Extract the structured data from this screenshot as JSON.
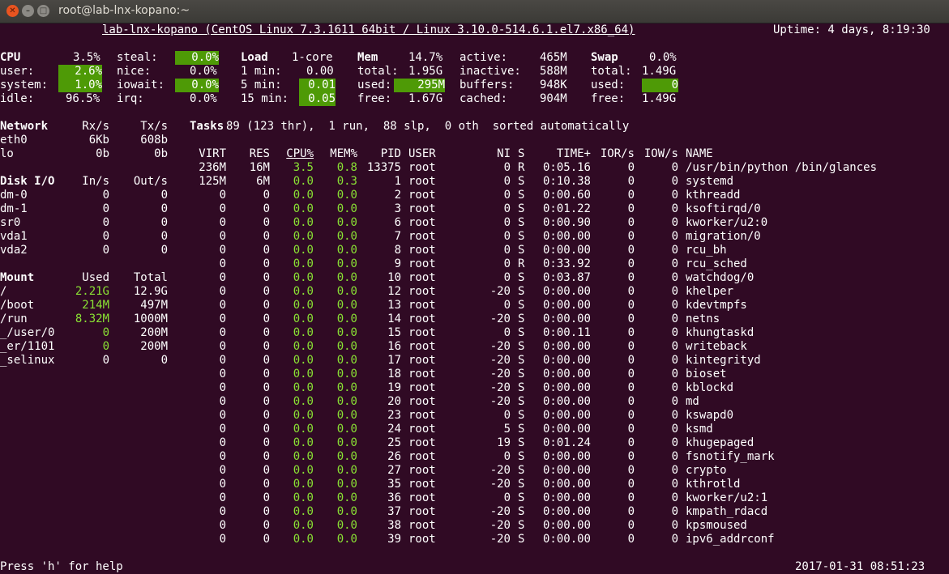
{
  "window": {
    "title": "root@lab-lnx-kopano:~",
    "close_glyph": "✕",
    "minimize_glyph": "–",
    "maximize_glyph": "□"
  },
  "header": {
    "system": "lab-lnx-kopano (CentOS Linux 7.3.1611 64bit / Linux 3.10.0-514.6.1.el7.x86_64)",
    "uptime": "Uptime: 4 days, 8:19:30"
  },
  "cpu": {
    "title": "CPU",
    "total": "3.5%",
    "user_label": "user:",
    "user": "2.6%",
    "system_label": "system:",
    "system": "1.0%",
    "idle_label": "idle:",
    "idle": "96.5%",
    "steal_label": "steal:",
    "steal": "0.0%",
    "nice_label": "nice:",
    "nice": "0.0%",
    "iowait_label": "iowait:",
    "iowait": "0.0%",
    "irq_label": "irq:",
    "irq": "0.0%"
  },
  "load": {
    "title": "Load",
    "cores": "1-core",
    "min1_label": "1 min:",
    "min1": "0.00",
    "min5_label": "5 min:",
    "min5": "0.01",
    "min15_label": "15 min:",
    "min15": "0.05"
  },
  "mem": {
    "title": "Mem",
    "percent": "14.7%",
    "total_label": "total:",
    "total": "1.95G",
    "used_label": "used:",
    "used": "295M",
    "free_label": "free:",
    "free": "1.67G",
    "active_label": "active:",
    "active": "465M",
    "inactive_label": "inactive:",
    "inactive": "588M",
    "buffers_label": "buffers:",
    "buffers": "948K",
    "cached_label": "cached:",
    "cached": "904M"
  },
  "swap": {
    "title": "Swap",
    "percent": "0.0%",
    "total_label": "total:",
    "total": "1.49G",
    "used_label": "used:",
    "used": "0",
    "free_label": "free:",
    "free": "1.49G"
  },
  "network": {
    "title": "Network",
    "rx_header": "Rx/s",
    "tx_header": "Tx/s",
    "rows": [
      {
        "name": "eth0",
        "rx": "6Kb",
        "tx": "608b"
      },
      {
        "name": "lo",
        "rx": "0b",
        "tx": "0b"
      }
    ]
  },
  "disk": {
    "title": "Disk I/O",
    "in_header": "In/s",
    "out_header": "Out/s",
    "rows": [
      {
        "name": "dm-0",
        "in": "0",
        "out": "0"
      },
      {
        "name": "dm-1",
        "in": "0",
        "out": "0"
      },
      {
        "name": "sr0",
        "in": "0",
        "out": "0"
      },
      {
        "name": "vda1",
        "in": "0",
        "out": "0"
      },
      {
        "name": "vda2",
        "in": "0",
        "out": "0"
      }
    ]
  },
  "mount": {
    "title": "Mount",
    "used_header": "Used",
    "total_header": "Total",
    "rows": [
      {
        "name": "/",
        "used": "2.21G",
        "total": "12.9G",
        "used_green": true
      },
      {
        "name": "/boot",
        "used": "214M",
        "total": "497M",
        "used_green": true
      },
      {
        "name": "/run",
        "used": "8.32M",
        "total": "1000M",
        "used_green": true
      },
      {
        "name": "_/user/0",
        "used": "0",
        "total": "200M",
        "used_green": true
      },
      {
        "name": "_er/1101",
        "used": "0",
        "total": "200M",
        "used_green": true
      },
      {
        "name": "_selinux",
        "used": "0",
        "total": "0",
        "used_green": false
      }
    ]
  },
  "tasks": {
    "title": "Tasks",
    "summary": "89 (123 thr),  1 run,  88 slp,  0 oth  sorted automatically"
  },
  "proc_headers": {
    "virt": "VIRT",
    "res": "RES",
    "cpu": "CPU%",
    "mem": "MEM%",
    "pid": "PID",
    "user": "USER",
    "ni": "NI",
    "s": "S",
    "time": "TIME+",
    "ior": "IOR/s",
    "iow": "IOW/s",
    "name": "NAME"
  },
  "processes": [
    {
      "virt": "236M",
      "res": "16M",
      "cpu": "3.5",
      "mem": "0.8",
      "pid": "13375",
      "user": "root",
      "ni": "0",
      "s": "R",
      "time": "0:05.16",
      "ior": "0",
      "iow": "0",
      "name": "/usr/bin/python /bin/glances"
    },
    {
      "virt": "125M",
      "res": "6M",
      "cpu": "0.0",
      "mem": "0.3",
      "pid": "1",
      "user": "root",
      "ni": "0",
      "s": "S",
      "time": "0:10.38",
      "ior": "0",
      "iow": "0",
      "name": "systemd"
    },
    {
      "virt": "0",
      "res": "0",
      "cpu": "0.0",
      "mem": "0.0",
      "pid": "2",
      "user": "root",
      "ni": "0",
      "s": "S",
      "time": "0:00.60",
      "ior": "0",
      "iow": "0",
      "name": "kthreadd"
    },
    {
      "virt": "0",
      "res": "0",
      "cpu": "0.0",
      "mem": "0.0",
      "pid": "3",
      "user": "root",
      "ni": "0",
      "s": "S",
      "time": "0:01.22",
      "ior": "0",
      "iow": "0",
      "name": "ksoftirqd/0"
    },
    {
      "virt": "0",
      "res": "0",
      "cpu": "0.0",
      "mem": "0.0",
      "pid": "6",
      "user": "root",
      "ni": "0",
      "s": "S",
      "time": "0:00.90",
      "ior": "0",
      "iow": "0",
      "name": "kworker/u2:0"
    },
    {
      "virt": "0",
      "res": "0",
      "cpu": "0.0",
      "mem": "0.0",
      "pid": "7",
      "user": "root",
      "ni": "0",
      "s": "S",
      "time": "0:00.00",
      "ior": "0",
      "iow": "0",
      "name": "migration/0"
    },
    {
      "virt": "0",
      "res": "0",
      "cpu": "0.0",
      "mem": "0.0",
      "pid": "8",
      "user": "root",
      "ni": "0",
      "s": "S",
      "time": "0:00.00",
      "ior": "0",
      "iow": "0",
      "name": "rcu_bh"
    },
    {
      "virt": "0",
      "res": "0",
      "cpu": "0.0",
      "mem": "0.0",
      "pid": "9",
      "user": "root",
      "ni": "0",
      "s": "R",
      "time": "0:33.92",
      "ior": "0",
      "iow": "0",
      "name": "rcu_sched"
    },
    {
      "virt": "0",
      "res": "0",
      "cpu": "0.0",
      "mem": "0.0",
      "pid": "10",
      "user": "root",
      "ni": "0",
      "s": "S",
      "time": "0:03.87",
      "ior": "0",
      "iow": "0",
      "name": "watchdog/0"
    },
    {
      "virt": "0",
      "res": "0",
      "cpu": "0.0",
      "mem": "0.0",
      "pid": "12",
      "user": "root",
      "ni": "-20",
      "s": "S",
      "time": "0:00.00",
      "ior": "0",
      "iow": "0",
      "name": "khelper"
    },
    {
      "virt": "0",
      "res": "0",
      "cpu": "0.0",
      "mem": "0.0",
      "pid": "13",
      "user": "root",
      "ni": "0",
      "s": "S",
      "time": "0:00.00",
      "ior": "0",
      "iow": "0",
      "name": "kdevtmpfs"
    },
    {
      "virt": "0",
      "res": "0",
      "cpu": "0.0",
      "mem": "0.0",
      "pid": "14",
      "user": "root",
      "ni": "-20",
      "s": "S",
      "time": "0:00.00",
      "ior": "0",
      "iow": "0",
      "name": "netns"
    },
    {
      "virt": "0",
      "res": "0",
      "cpu": "0.0",
      "mem": "0.0",
      "pid": "15",
      "user": "root",
      "ni": "0",
      "s": "S",
      "time": "0:00.11",
      "ior": "0",
      "iow": "0",
      "name": "khungtaskd"
    },
    {
      "virt": "0",
      "res": "0",
      "cpu": "0.0",
      "mem": "0.0",
      "pid": "16",
      "user": "root",
      "ni": "-20",
      "s": "S",
      "time": "0:00.00",
      "ior": "0",
      "iow": "0",
      "name": "writeback"
    },
    {
      "virt": "0",
      "res": "0",
      "cpu": "0.0",
      "mem": "0.0",
      "pid": "17",
      "user": "root",
      "ni": "-20",
      "s": "S",
      "time": "0:00.00",
      "ior": "0",
      "iow": "0",
      "name": "kintegrityd"
    },
    {
      "virt": "0",
      "res": "0",
      "cpu": "0.0",
      "mem": "0.0",
      "pid": "18",
      "user": "root",
      "ni": "-20",
      "s": "S",
      "time": "0:00.00",
      "ior": "0",
      "iow": "0",
      "name": "bioset"
    },
    {
      "virt": "0",
      "res": "0",
      "cpu": "0.0",
      "mem": "0.0",
      "pid": "19",
      "user": "root",
      "ni": "-20",
      "s": "S",
      "time": "0:00.00",
      "ior": "0",
      "iow": "0",
      "name": "kblockd"
    },
    {
      "virt": "0",
      "res": "0",
      "cpu": "0.0",
      "mem": "0.0",
      "pid": "20",
      "user": "root",
      "ni": "-20",
      "s": "S",
      "time": "0:00.00",
      "ior": "0",
      "iow": "0",
      "name": "md"
    },
    {
      "virt": "0",
      "res": "0",
      "cpu": "0.0",
      "mem": "0.0",
      "pid": "23",
      "user": "root",
      "ni": "0",
      "s": "S",
      "time": "0:00.00",
      "ior": "0",
      "iow": "0",
      "name": "kswapd0"
    },
    {
      "virt": "0",
      "res": "0",
      "cpu": "0.0",
      "mem": "0.0",
      "pid": "24",
      "user": "root",
      "ni": "5",
      "s": "S",
      "time": "0:00.00",
      "ior": "0",
      "iow": "0",
      "name": "ksmd"
    },
    {
      "virt": "0",
      "res": "0",
      "cpu": "0.0",
      "mem": "0.0",
      "pid": "25",
      "user": "root",
      "ni": "19",
      "s": "S",
      "time": "0:01.24",
      "ior": "0",
      "iow": "0",
      "name": "khugepaged"
    },
    {
      "virt": "0",
      "res": "0",
      "cpu": "0.0",
      "mem": "0.0",
      "pid": "26",
      "user": "root",
      "ni": "0",
      "s": "S",
      "time": "0:00.00",
      "ior": "0",
      "iow": "0",
      "name": "fsnotify_mark"
    },
    {
      "virt": "0",
      "res": "0",
      "cpu": "0.0",
      "mem": "0.0",
      "pid": "27",
      "user": "root",
      "ni": "-20",
      "s": "S",
      "time": "0:00.00",
      "ior": "0",
      "iow": "0",
      "name": "crypto"
    },
    {
      "virt": "0",
      "res": "0",
      "cpu": "0.0",
      "mem": "0.0",
      "pid": "35",
      "user": "root",
      "ni": "-20",
      "s": "S",
      "time": "0:00.00",
      "ior": "0",
      "iow": "0",
      "name": "kthrotld"
    },
    {
      "virt": "0",
      "res": "0",
      "cpu": "0.0",
      "mem": "0.0",
      "pid": "36",
      "user": "root",
      "ni": "0",
      "s": "S",
      "time": "0:00.00",
      "ior": "0",
      "iow": "0",
      "name": "kworker/u2:1"
    },
    {
      "virt": "0",
      "res": "0",
      "cpu": "0.0",
      "mem": "0.0",
      "pid": "37",
      "user": "root",
      "ni": "-20",
      "s": "S",
      "time": "0:00.00",
      "ior": "0",
      "iow": "0",
      "name": "kmpath_rdacd"
    },
    {
      "virt": "0",
      "res": "0",
      "cpu": "0.0",
      "mem": "0.0",
      "pid": "38",
      "user": "root",
      "ni": "-20",
      "s": "S",
      "time": "0:00.00",
      "ior": "0",
      "iow": "0",
      "name": "kpsmoused"
    },
    {
      "virt": "0",
      "res": "0",
      "cpu": "0.0",
      "mem": "0.0",
      "pid": "39",
      "user": "root",
      "ni": "-20",
      "s": "S",
      "time": "0:00.00",
      "ior": "0",
      "iow": "0",
      "name": "ipv6_addrconf"
    }
  ],
  "footer": {
    "help": "Press 'h' for help",
    "datetime": "2017-01-31 08:51:23"
  },
  "colors": {
    "background": "#300a24",
    "highlight": "#4e9a06",
    "green_text": "#8ae234"
  }
}
